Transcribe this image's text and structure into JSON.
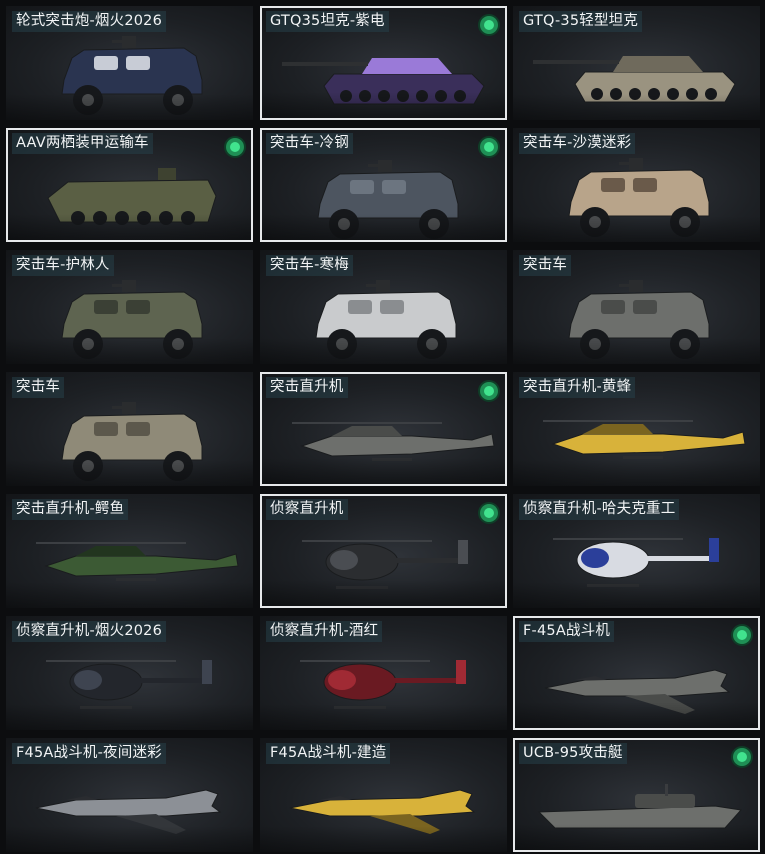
{
  "colors": {
    "owned_badge": "#41e38e",
    "selected_border": "#e6e8ea",
    "label_bg": "#264048"
  },
  "grid": {
    "columns": 3,
    "items": [
      {
        "label": "轮式突击炮-烟火2026",
        "kind": "apc",
        "skin": "firework",
        "selected": false,
        "owned": false
      },
      {
        "label": "GTQ35坦克-紫电",
        "kind": "tank",
        "skin": "purple",
        "selected": true,
        "owned": true
      },
      {
        "label": "GTQ-35轻型坦克",
        "kind": "tank",
        "skin": "tan",
        "selected": false,
        "owned": false
      },
      {
        "label": "AAV两栖装甲运输车",
        "kind": "aav",
        "skin": "olive",
        "selected": true,
        "owned": true
      },
      {
        "label": "突击车-冷钢",
        "kind": "truck",
        "skin": "steel",
        "selected": true,
        "owned": true
      },
      {
        "label": "突击车-沙漠迷彩",
        "kind": "truck",
        "skin": "desert",
        "selected": false,
        "owned": false
      },
      {
        "label": "突击车-护林人",
        "kind": "truck",
        "skin": "forest",
        "selected": false,
        "owned": false
      },
      {
        "label": "突击车-寒梅",
        "kind": "truck",
        "skin": "white",
        "selected": false,
        "owned": false
      },
      {
        "label": "突击车",
        "kind": "truck",
        "skin": "gray",
        "selected": false,
        "owned": false
      },
      {
        "label": "突击车",
        "kind": "truck",
        "skin": "sand",
        "selected": false,
        "owned": false
      },
      {
        "label": "突击直升机",
        "kind": "apache",
        "skin": "gray",
        "selected": true,
        "owned": true
      },
      {
        "label": "突击直升机-黄蜂",
        "kind": "apache",
        "skin": "yellow",
        "selected": false,
        "owned": false
      },
      {
        "label": "突击直升机-鳄鱼",
        "kind": "apache",
        "skin": "green",
        "selected": false,
        "owned": false
      },
      {
        "label": "侦察直升机",
        "kind": "scout",
        "skin": "black",
        "selected": true,
        "owned": true
      },
      {
        "label": "侦察直升机-哈夫克重工",
        "kind": "scout",
        "skin": "blue",
        "selected": false,
        "owned": false
      },
      {
        "label": "侦察直升机-烟火2026",
        "kind": "scout",
        "skin": "dark",
        "selected": false,
        "owned": false
      },
      {
        "label": "侦察直升机-酒红",
        "kind": "scout",
        "skin": "red",
        "selected": false,
        "owned": false
      },
      {
        "label": "F-45A战斗机",
        "kind": "jet",
        "skin": "gray",
        "selected": true,
        "owned": true
      },
      {
        "label": "F45A战斗机-夜间迷彩",
        "kind": "jet",
        "skin": "camo",
        "selected": false,
        "owned": false
      },
      {
        "label": "F45A战斗机-建造",
        "kind": "jet",
        "skin": "yellow",
        "selected": false,
        "owned": false
      },
      {
        "label": "UCB-95攻击艇",
        "kind": "boat",
        "skin": "gray",
        "selected": true,
        "owned": true
      }
    ]
  }
}
